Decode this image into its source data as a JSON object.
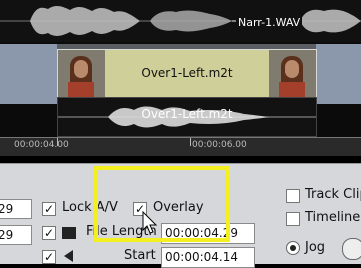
{
  "timeline": {
    "narration_clip": "Narr-1.WAV",
    "video_clip": "Over1-Left.m2t",
    "audio_clip": "Over1-Left.m2t",
    "ruler": {
      "left_time": "00:00:04.00",
      "right_time": "00:00:06.00"
    }
  },
  "panel": {
    "left_fields": [
      "29",
      "29"
    ],
    "lock_av": {
      "label": "Lock A/V",
      "checked": true
    },
    "overlay": {
      "label": "Overlay",
      "checked": true
    },
    "file_length": {
      "label": "File Length",
      "value": "00:00:04.29"
    },
    "start": {
      "label": "Start",
      "value": "00:00:04.14"
    },
    "track_clip": {
      "label": "Track Clip",
      "checked": false
    },
    "timeline": {
      "label": "Timeline",
      "checked": false
    },
    "jog": {
      "label": "Jog",
      "selected": true
    }
  },
  "icons": {
    "film": "film-icon",
    "speaker": "speaker-icon",
    "cursor": "mouse-cursor-icon"
  },
  "colors": {
    "highlight": "#f4ef20",
    "clip_video_bg": "#cfcf9a",
    "track_bg": "#8b97ab"
  }
}
